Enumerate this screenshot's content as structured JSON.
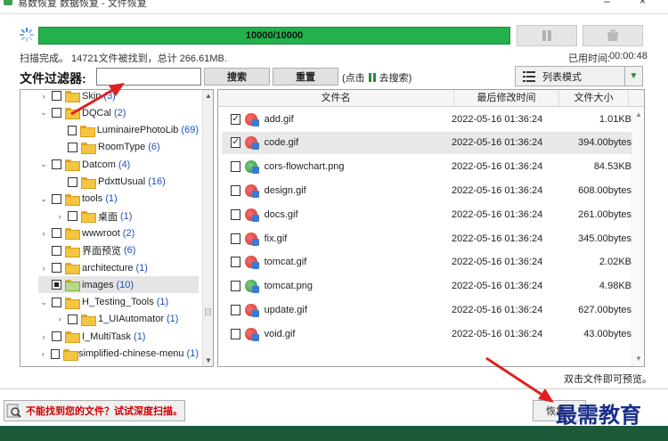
{
  "window": {
    "title": "易数恢复 数据恢复 - 文件恢复"
  },
  "progress": {
    "text": "10000/10000",
    "value": 1.0
  },
  "status": {
    "scan_info": "扫描完成。 14721文件被找到，总计 266.61MB.",
    "elapsed_label": "已用时间:",
    "elapsed_value": "00:00:48"
  },
  "filter": {
    "label": "文件过滤器:",
    "input_value": "",
    "search_button": "搜索",
    "reset_button": "重置",
    "hint_prefix": "(点击",
    "hint_suffix": "去搜索)",
    "view_mode": "列表模式"
  },
  "tree": [
    {
      "name": "Skin",
      "count": "(3)",
      "chev": "›",
      "checked": "none"
    },
    {
      "name": "DQCal",
      "count": "(2)",
      "chev": "⌄",
      "checked": "none"
    },
    {
      "name": "LuminairePhotoLib",
      "count": "(69)",
      "chev": "",
      "checked": "none"
    },
    {
      "name": "RoomType",
      "count": "(6)",
      "chev": "",
      "checked": "none"
    },
    {
      "name": "Datcom",
      "count": "(4)",
      "chev": "⌄",
      "checked": "none"
    },
    {
      "name": "PdxttUsual",
      "count": "(16)",
      "chev": "",
      "checked": "none"
    },
    {
      "name": "tools",
      "count": "(1)",
      "chev": "⌄",
      "checked": "none"
    },
    {
      "name": "桌面",
      "count": "(1)",
      "chev": "›",
      "checked": "none"
    },
    {
      "name": "wwwroot",
      "count": "(2)",
      "chev": "›",
      "checked": "none"
    },
    {
      "name": "界面预览",
      "count": "(6)",
      "chev": "",
      "checked": "none"
    },
    {
      "name": "architecture",
      "count": "(1)",
      "chev": "›",
      "checked": "none"
    },
    {
      "name": "images",
      "count": "(10)",
      "chev": "",
      "checked": "partial"
    },
    {
      "name": "H_Testing_Tools",
      "count": "(1)",
      "chev": "⌄",
      "checked": "none"
    },
    {
      "name": "1_UIAutomator",
      "count": "(1)",
      "chev": "›",
      "checked": "none"
    },
    {
      "name": "I_MultiTask",
      "count": "(1)",
      "chev": "›",
      "checked": "none"
    },
    {
      "name": "simplified-chinese-menu",
      "count": "(1)",
      "chev": "›",
      "checked": "none"
    }
  ],
  "list": {
    "columns": {
      "name": "文件名",
      "date": "最后修改时间",
      "size": "文件大小"
    },
    "rows": [
      {
        "name": "add.gif",
        "date": "2022-05-16 01:36:24",
        "size": "1.01KB",
        "type": "gif",
        "checked": true
      },
      {
        "name": "code.gif",
        "date": "2022-05-16 01:36:24",
        "size": "394.00bytes",
        "type": "gif",
        "checked": true
      },
      {
        "name": "cors-flowchart.png",
        "date": "2022-05-16 01:36:24",
        "size": "84.53KB",
        "type": "png",
        "checked": false
      },
      {
        "name": "design.gif",
        "date": "2022-05-16 01:36:24",
        "size": "608.00bytes",
        "type": "gif",
        "checked": false
      },
      {
        "name": "docs.gif",
        "date": "2022-05-16 01:36:24",
        "size": "261.00bytes",
        "type": "gif",
        "checked": false
      },
      {
        "name": "fix.gif",
        "date": "2022-05-16 01:36:24",
        "size": "345.00bytes",
        "type": "gif",
        "checked": false
      },
      {
        "name": "tomcat.gif",
        "date": "2022-05-16 01:36:24",
        "size": "2.02KB",
        "type": "gif",
        "checked": false
      },
      {
        "name": "tomcat.png",
        "date": "2022-05-16 01:36:24",
        "size": "4.98KB",
        "type": "png",
        "checked": false
      },
      {
        "name": "update.gif",
        "date": "2022-05-16 01:36:24",
        "size": "627.00bytes",
        "type": "gif",
        "checked": false
      },
      {
        "name": "void.gif",
        "date": "2022-05-16 01:36:24",
        "size": "43.00bytes",
        "type": "gif",
        "checked": false
      }
    ]
  },
  "footer": {
    "double_click_hint": "双击文件即可预览。",
    "deep_scan": "不能找到您的文件？试试深度扫描。",
    "recover_button": "恢复"
  },
  "watermark": "最需教育",
  "colors": {
    "progress": "#22b14c",
    "accent": "#2a8a3e",
    "warning": "#d10000"
  }
}
